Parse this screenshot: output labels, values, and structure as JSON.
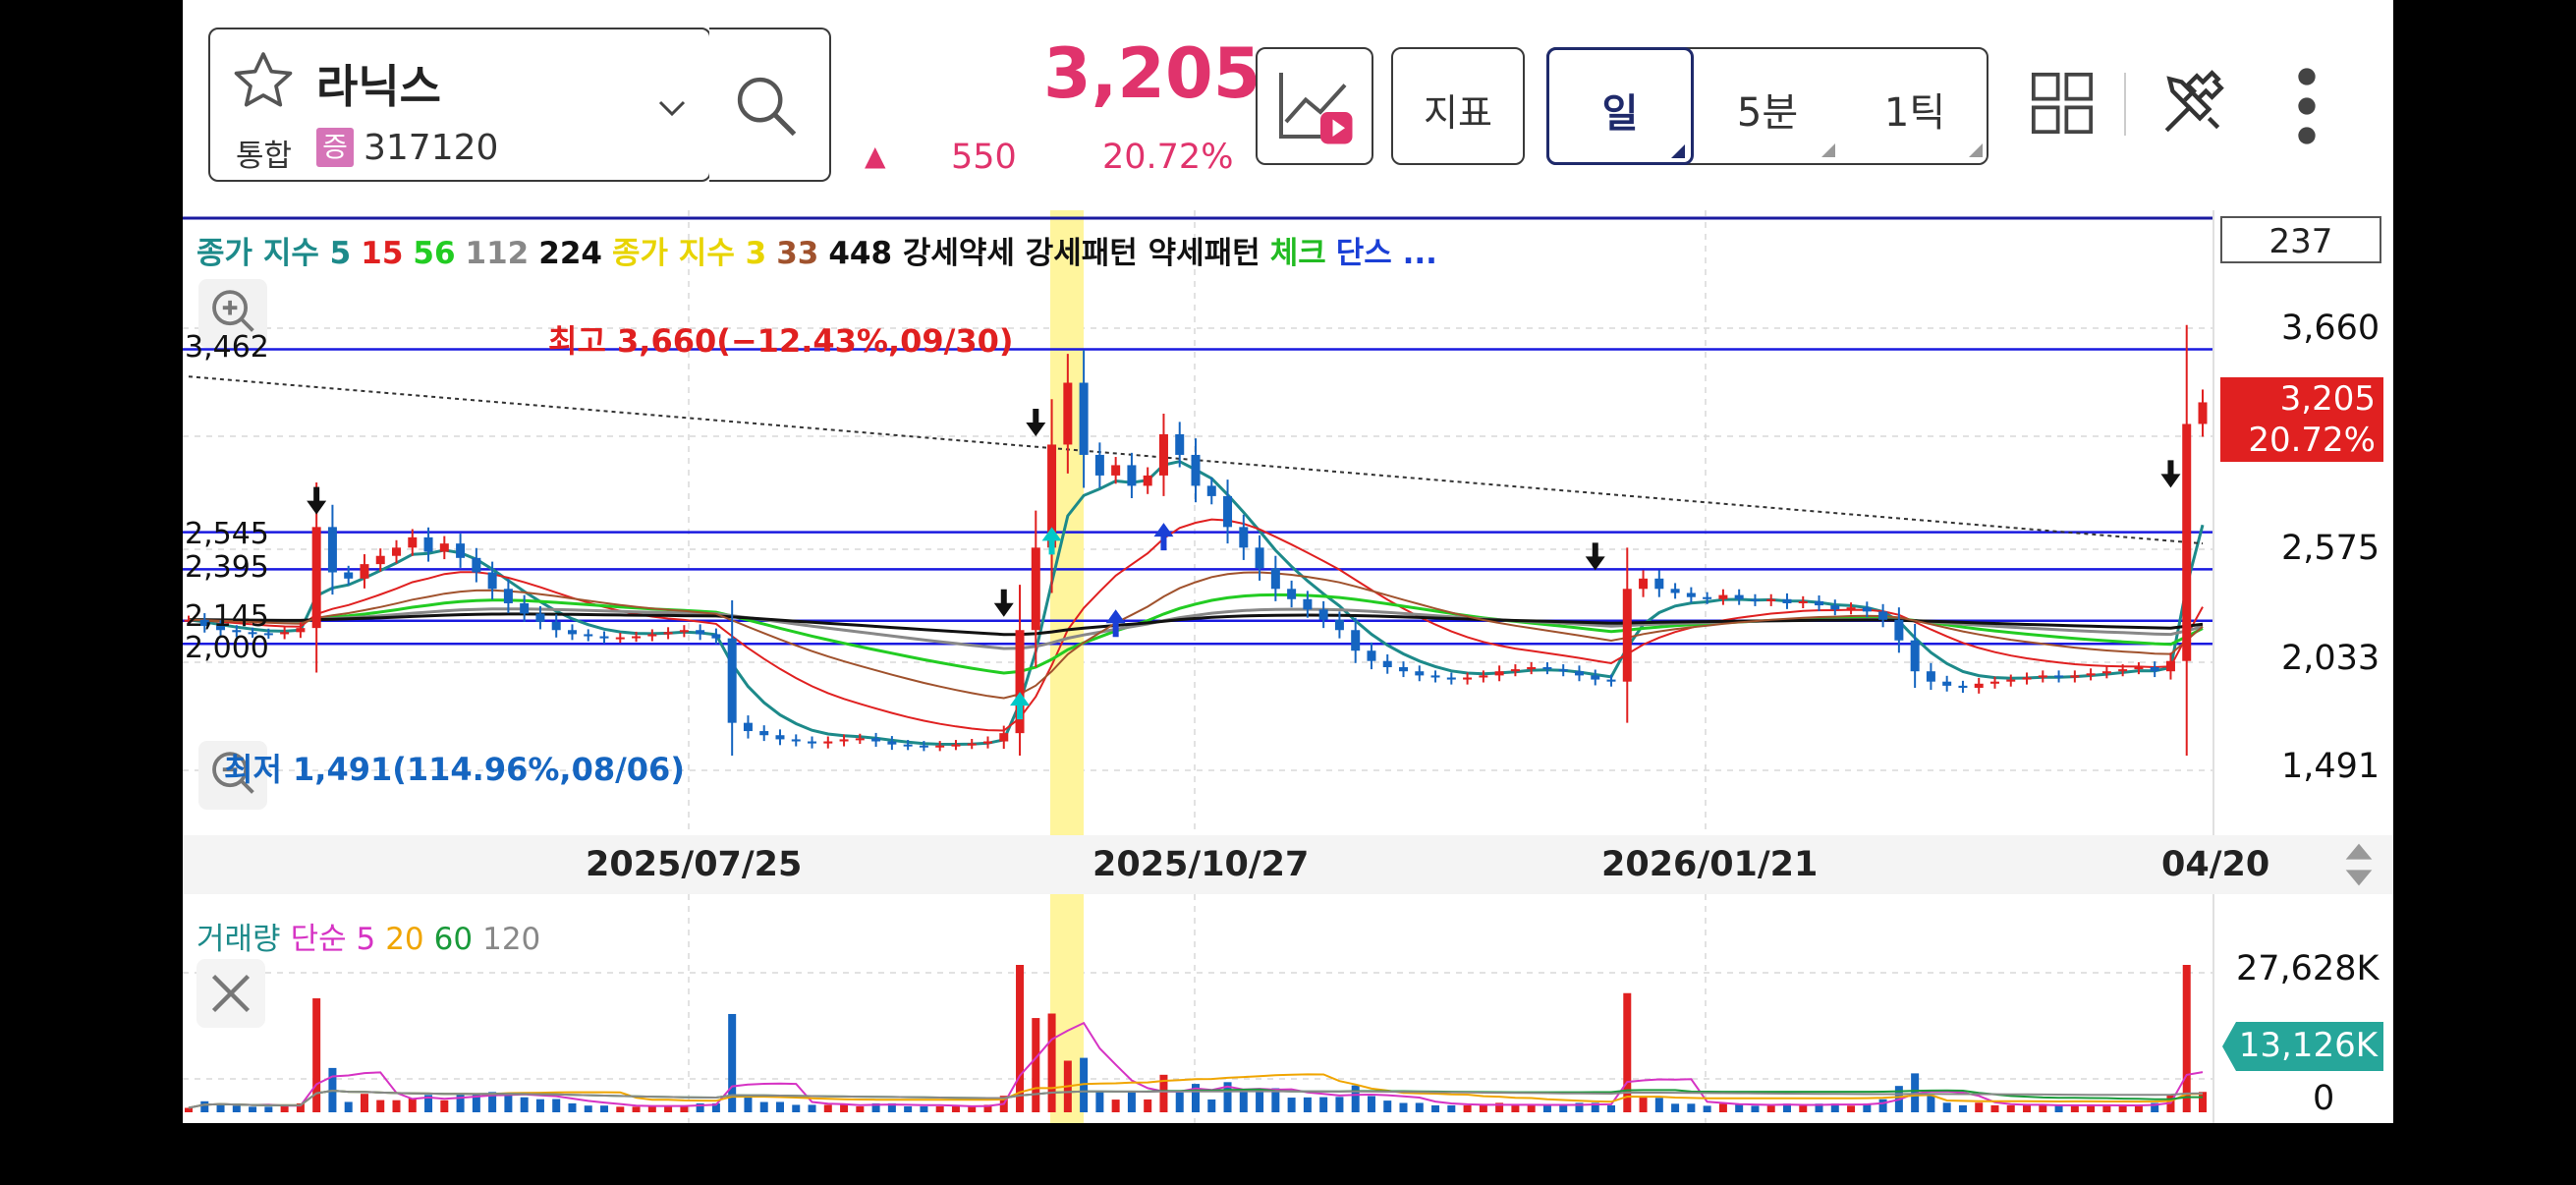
{
  "header": {
    "stock_name": "라닉스",
    "market_label": "통합",
    "badge_text": "증",
    "stock_code": "317120",
    "current_price": "3,205",
    "change_arrow": "▲",
    "change_value": "550",
    "change_pct": "20.72%",
    "indicator_button": "지표",
    "period_tabs": [
      "일",
      "5분",
      "1틱"
    ]
  },
  "colors": {
    "price_up": "#e0336c",
    "accent_blue": "#1f2a6b",
    "candle_up": "#e02020",
    "candle_down": "#1565c0",
    "highlight": "#fff59d",
    "volume_badge": "#26a69a"
  },
  "price_panel": {
    "legend": [
      {
        "text": "종가 지수 5",
        "color": "#1d8a8a"
      },
      {
        "text": "15",
        "color": "#e02020"
      },
      {
        "text": "56",
        "color": "#22cc22"
      },
      {
        "text": "112",
        "color": "#888888"
      },
      {
        "text": "224",
        "color": "#111111"
      },
      {
        "text": "종가 지수 3",
        "color": "#e8d400"
      },
      {
        "text": "33",
        "color": "#a0522d"
      },
      {
        "text": "448 강세약세 강세패턴 약세패턴",
        "color": "#111111"
      },
      {
        "text": "체크",
        "color": "#22bb22"
      },
      {
        "text": "단스 ...",
        "color": "#1a3fd6"
      }
    ],
    "count_box": "237",
    "high_annotation": "최고 3,660(−12.43%,09/30)",
    "low_annotation": "최저 1,491(114.96%,08/06)",
    "left_levels": [
      "3,462",
      "2,545",
      "2,395",
      "2,145",
      "2,000"
    ],
    "right_axis": [
      "3,660",
      "2,575",
      "2,033",
      "1,491"
    ],
    "current_price_tag": "3,205",
    "current_pct_tag": "20.72%"
  },
  "x_axis": [
    "2025/07/25",
    "2025/10/27",
    "2026/01/21",
    "04/20"
  ],
  "volume_panel": {
    "legend": [
      {
        "text": "거래량",
        "color": "#1d8a8a"
      },
      {
        "text": "단순 5",
        "color": "#d633c4"
      },
      {
        "text": "20",
        "color": "#f0a500"
      },
      {
        "text": "60",
        "color": "#1a9a3a"
      },
      {
        "text": "120",
        "color": "#888888"
      }
    ],
    "right_axis": [
      "27,628K",
      "0"
    ],
    "current_volume_tag": "13,126K"
  },
  "chart_data": {
    "type": "candlestick",
    "y_range": [
      1491,
      3660
    ],
    "high": 3660,
    "low": 1491,
    "last_close": 3205,
    "horizontal_levels": [
      3462,
      2575,
      2395,
      2145,
      2033
    ],
    "close_series": [
      2150,
      2120,
      2100,
      2090,
      2085,
      2080,
      2090,
      2110,
      2600,
      2380,
      2350,
      2420,
      2460,
      2500,
      2550,
      2480,
      2520,
      2450,
      2380,
      2300,
      2230,
      2180,
      2140,
      2100,
      2080,
      2070,
      2060,
      2065,
      2070,
      2080,
      2090,
      2100,
      2080,
      2060,
      1650,
      1610,
      1590,
      1570,
      1560,
      1550,
      1560,
      1570,
      1575,
      1560,
      1545,
      1540,
      1535,
      1540,
      1545,
      1550,
      1560,
      1600,
      2100,
      2500,
      3000,
      3300,
      2950,
      2850,
      2900,
      2800,
      2850,
      3050,
      2950,
      2800,
      2750,
      2600,
      2500,
      2400,
      2300,
      2250,
      2200,
      2150,
      2100,
      2000,
      1950,
      1920,
      1900,
      1880,
      1870,
      1860,
      1870,
      1880,
      1900,
      1910,
      1920,
      1910,
      1900,
      1880,
      1860,
      1850,
      2300,
      2350,
      2300,
      2280,
      2260,
      2250,
      2270,
      2250,
      2240,
      2250,
      2230,
      2240,
      2220,
      2200,
      2210,
      2190,
      2150,
      2050,
      1900,
      1850,
      1830,
      1820,
      1840,
      1850,
      1860,
      1870,
      1880,
      1870,
      1880,
      1890,
      1900,
      1910,
      1920,
      1900,
      1950,
      3100,
      3205
    ]
  }
}
